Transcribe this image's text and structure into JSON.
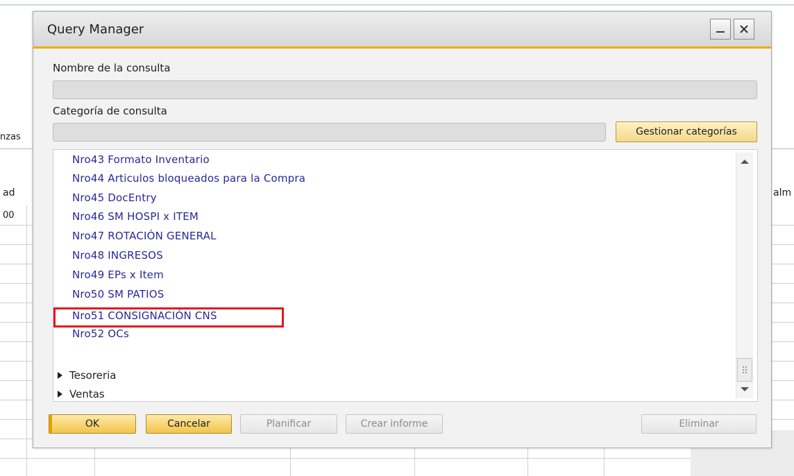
{
  "background_app": {
    "left_fragment_tab": "nzas",
    "left_fragment_col": "ad",
    "left_fragment_value": "00",
    "right_fragment_col": "alm"
  },
  "dialog": {
    "title": "Query Manager",
    "query_name_label": "Nombre de la consulta",
    "query_name_value": "",
    "category_label": "Categoría de consulta",
    "category_value": "",
    "manage_categories_label": "Gestionar categorías"
  },
  "queries": [
    "Nro43 Formato Inventario",
    "Nro44 Articulos bloqueados para la Compra",
    "Nro45 DocEntry",
    "Nro46 SM HOSPI x ITEM",
    "Nro47 ROTACIÓN GENERAL",
    "Nro48 INGRESOS",
    "Nro49 EPs x Item",
    "Nro50 SM PATIOS",
    "Nro51 CONSIGNACIÓN CNS",
    "Nro52 OCs"
  ],
  "highlighted_query": "Nro51 CONSIGNACIÓN CNS",
  "categories": [
    "Tesoreria",
    "Ventas"
  ],
  "buttons": {
    "ok": "OK",
    "cancel": "Cancelar",
    "plan": "Planificar",
    "create_report": "Crear informe",
    "delete": "Eliminar"
  },
  "colors": {
    "accent": "#f0ab00",
    "query_text": "#27289a",
    "highlight": "#e8151a"
  }
}
